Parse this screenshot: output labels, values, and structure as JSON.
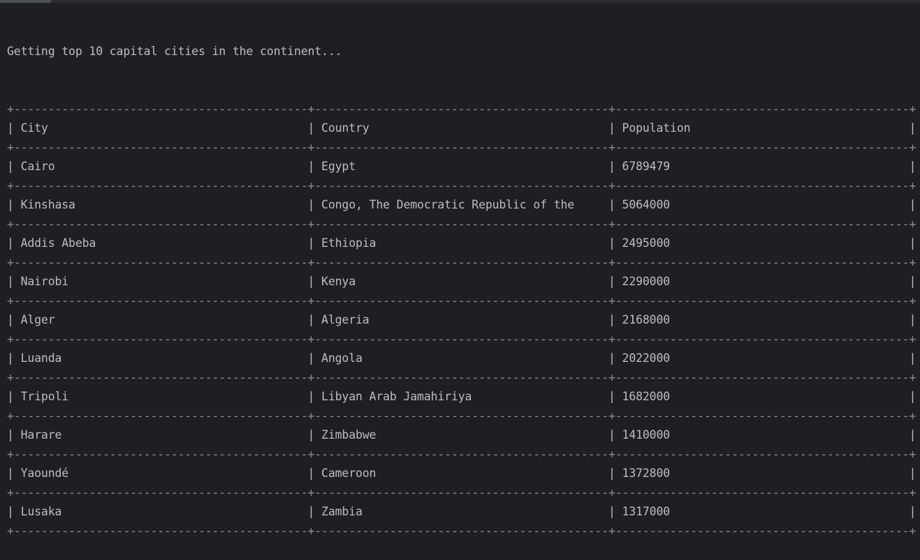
{
  "console": {
    "status_message": "Getting top 10 capital cities in the continent..."
  },
  "table": {
    "headers": [
      "City",
      "Country",
      "Population"
    ],
    "rows": [
      [
        "Cairo",
        "Egypt",
        "6789479"
      ],
      [
        "Kinshasa",
        "Congo, The Democratic Republic of the",
        "5064000"
      ],
      [
        "Addis Abeba",
        "Ethiopia",
        "2495000"
      ],
      [
        "Nairobi",
        "Kenya",
        "2290000"
      ],
      [
        "Alger",
        "Algeria",
        "2168000"
      ],
      [
        "Luanda",
        "Angola",
        "2022000"
      ],
      [
        "Tripoli",
        "Libyan Arab Jamahiriya",
        "1682000"
      ],
      [
        "Harare",
        "Zimbabwe",
        "1410000"
      ],
      [
        "Yaoundé",
        "Cameroon",
        "1372800"
      ],
      [
        "Lusaka",
        "Zambia",
        "1317000"
      ]
    ]
  }
}
